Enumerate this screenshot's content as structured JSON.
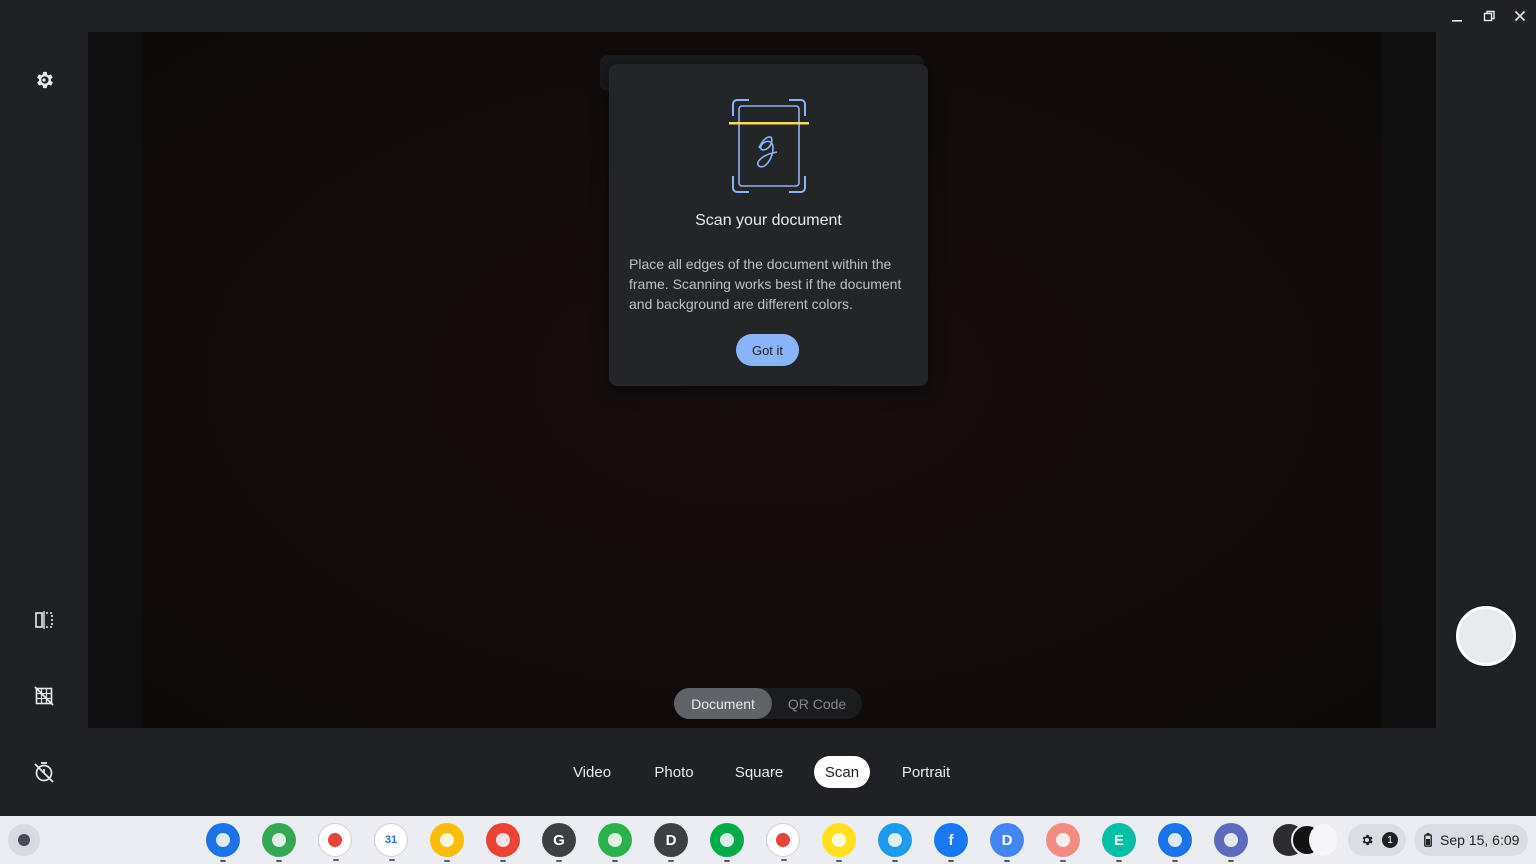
{
  "dialog": {
    "title": "Scan your document",
    "body": "Place all edges of the document within the frame. Scanning works best if the document and background are different colors.",
    "button": "Got it"
  },
  "scan_types": {
    "document": "Document",
    "qr": "QR Code"
  },
  "modes": [
    {
      "label": "Video"
    },
    {
      "label": "Photo"
    },
    {
      "label": "Square"
    },
    {
      "label": "Scan"
    },
    {
      "label": "Portrait"
    }
  ],
  "active_mode": "Scan",
  "shelf": {
    "apps": [
      {
        "name": "files",
        "color": "#1a73e8"
      },
      {
        "name": "chrome",
        "color": "#34a853"
      },
      {
        "name": "gmail",
        "color": "#ffffff"
      },
      {
        "name": "calendar",
        "color": "#ffffff",
        "glyph": "31"
      },
      {
        "name": "keep",
        "color": "#fbbc04"
      },
      {
        "name": "chrome-canary",
        "color": "#ea4335"
      },
      {
        "name": "g-app",
        "color": "#3c4043",
        "glyph": "G"
      },
      {
        "name": "feedly",
        "color": "#2bb24c"
      },
      {
        "name": "d-app",
        "color": "#3c4043",
        "glyph": "D"
      },
      {
        "name": "chat",
        "color": "#00ac47"
      },
      {
        "name": "photos",
        "color": "#ffffff"
      },
      {
        "name": "mailchimp",
        "color": "#ffe01b"
      },
      {
        "name": "twitter",
        "color": "#1d9bf0"
      },
      {
        "name": "facebook",
        "color": "#1877f2",
        "glyph": "f"
      },
      {
        "name": "docs-scanner",
        "color": "#4285f4",
        "glyph": "D"
      },
      {
        "name": "calc-app",
        "color": "#f28b82"
      },
      {
        "name": "e-app",
        "color": "#00bfa5",
        "glyph": "E"
      },
      {
        "name": "camera",
        "color": "#1a73e8"
      },
      {
        "name": "doodle",
        "color": "#5c6bc0"
      }
    ],
    "notification_count": "1",
    "date_time": "Sep 15, 6:09"
  }
}
